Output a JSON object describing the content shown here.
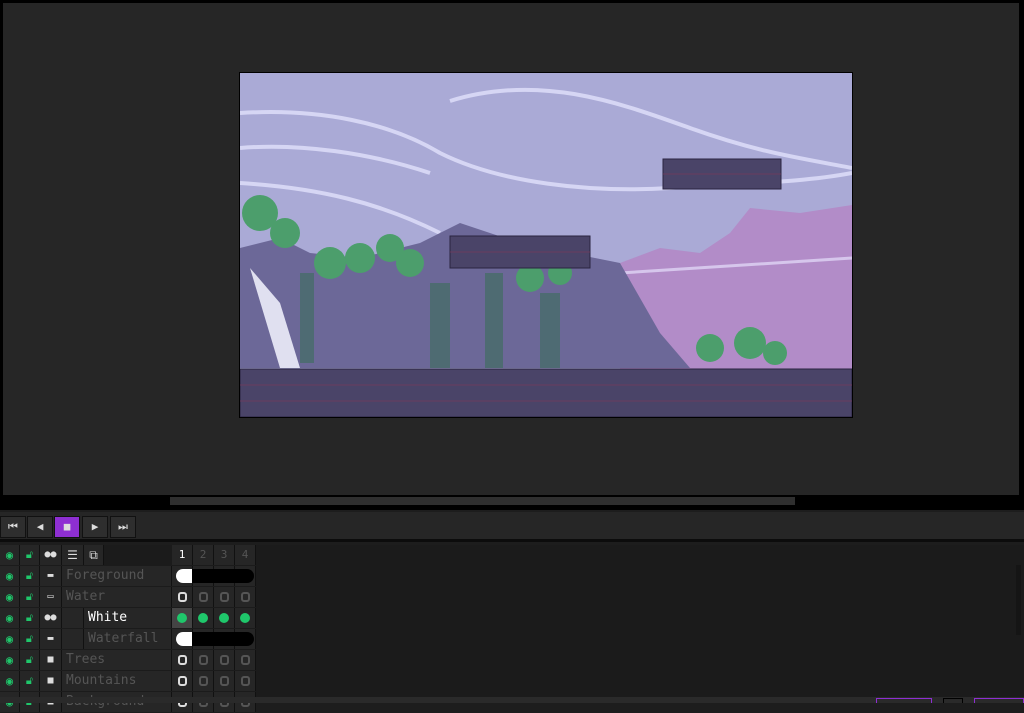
{
  "playback": {
    "buttons": [
      {
        "name": "first-frame",
        "icon": "⏮"
      },
      {
        "name": "previous-frame",
        "icon": "◀"
      },
      {
        "name": "play-stop",
        "icon": "■",
        "active": true
      },
      {
        "name": "next-frame",
        "icon": "▶"
      },
      {
        "name": "last-frame",
        "icon": "⏭"
      }
    ]
  },
  "timeline": {
    "frames": [
      "1",
      "2",
      "3",
      "4"
    ],
    "current_frame": "1",
    "layers": [
      {
        "name": "Foreground",
        "type": "continuous",
        "cels": "linked"
      },
      {
        "name": "Water",
        "type": "group",
        "cels": "empty"
      },
      {
        "name": "White",
        "type": "continuous-child",
        "selected": true,
        "cels": "filled"
      },
      {
        "name": "Waterfall",
        "type": "continuous-child",
        "cels": "linked"
      },
      {
        "name": "Trees",
        "type": "layer",
        "cels": "empty"
      },
      {
        "name": "Mountains",
        "type": "layer",
        "cels": "empty"
      },
      {
        "name": "Background",
        "type": "layer",
        "cels": "empty"
      }
    ]
  },
  "colors": {
    "accent": "#8e2fd2",
    "visible": "#1fc76b",
    "cel_fill": "#1fc76b"
  }
}
